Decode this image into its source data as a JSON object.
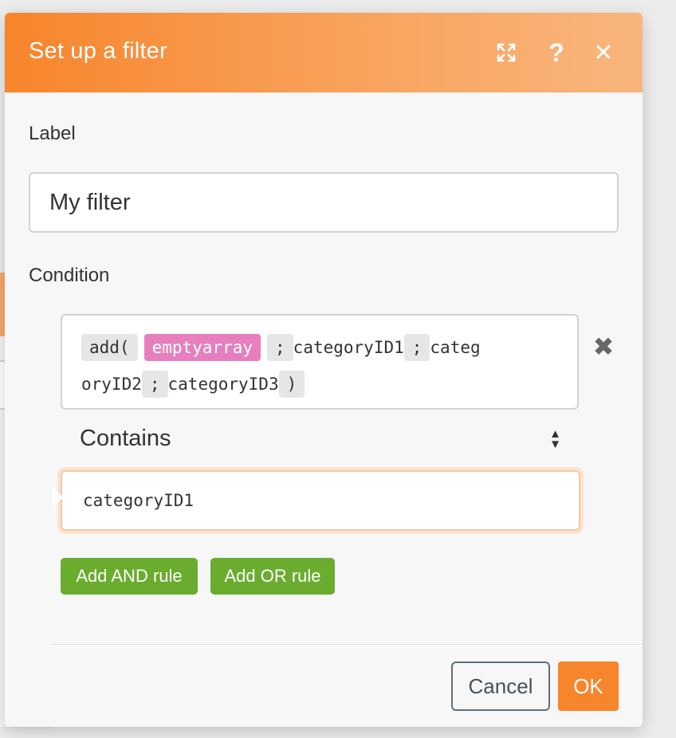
{
  "dialog": {
    "title": "Set up a filter",
    "expand_icon": "expand-arrows-icon",
    "help_label": "?",
    "close_label": "✕"
  },
  "label_field": {
    "label": "Label",
    "value": "My filter"
  },
  "condition": {
    "label": "Condition",
    "expression": {
      "fn_open": "add(",
      "arg1": "emptyarray",
      "sep1": ";",
      "arg2": "categoryID1",
      "sep2": ";",
      "arg3_part1": "categ",
      "arg3_part2": "oryID2",
      "sep3": ";",
      "arg4": "categoryID3",
      "fn_close": ")"
    },
    "remove_label": "✖",
    "operator": "Contains",
    "value": "categoryID1"
  },
  "buttons": {
    "add_and": "Add AND rule",
    "add_or": "Add OR rule",
    "cancel": "Cancel",
    "ok": "OK"
  },
  "background_panel": {
    "close_label": "✕"
  },
  "colors": {
    "accent_orange": "#f7852b",
    "rule_green": "#6aac2e",
    "function_token_pink": "#e77fbe"
  }
}
